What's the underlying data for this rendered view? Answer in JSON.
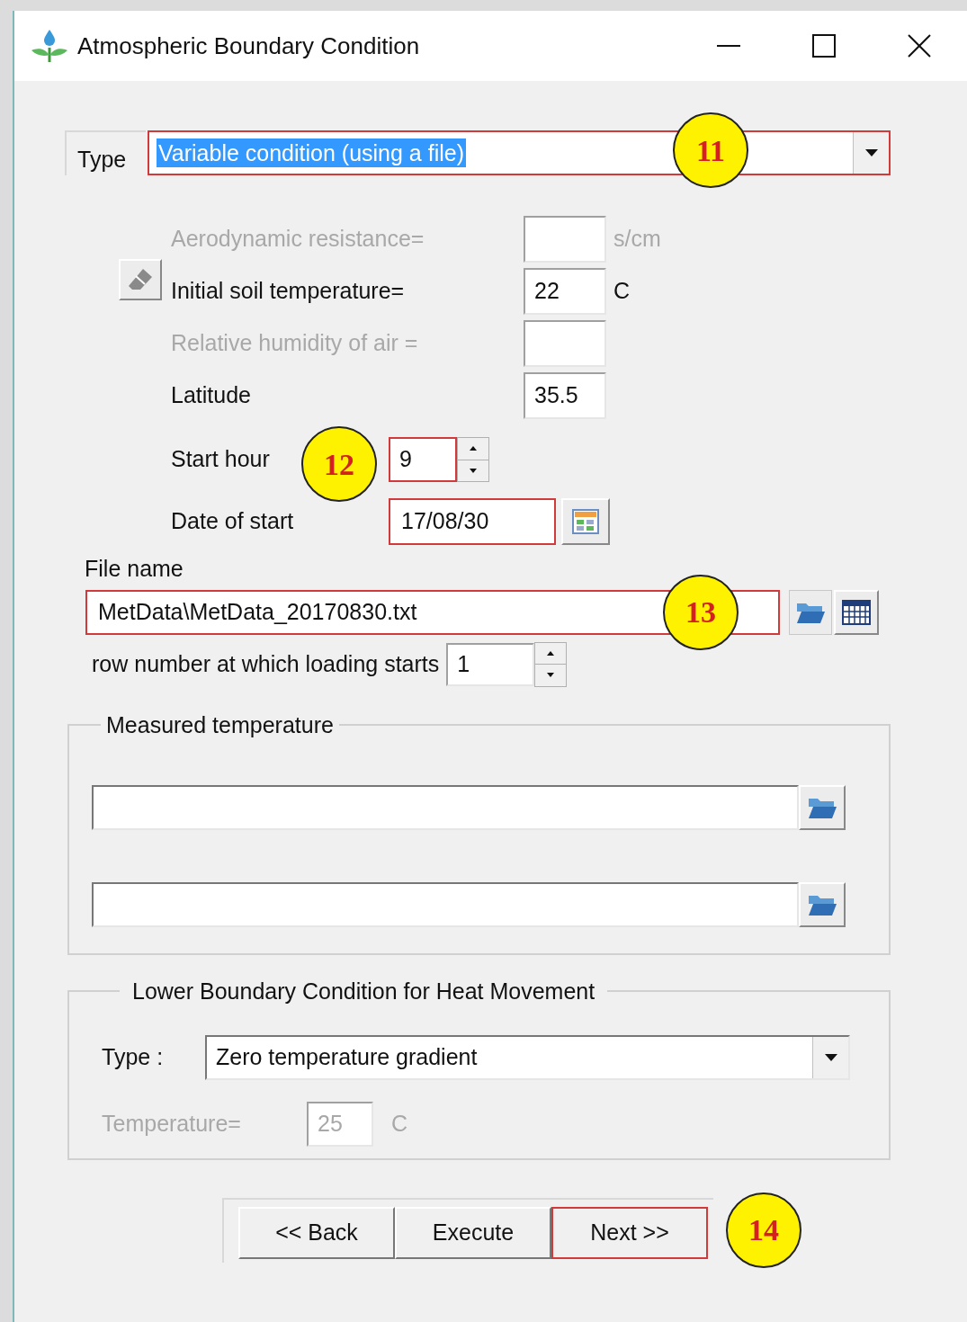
{
  "window": {
    "title": "Atmospheric Boundary Condition"
  },
  "type": {
    "label": "Type",
    "value": "Variable condition (using a file)",
    "highlighted": true,
    "callout": "11"
  },
  "parameters": [
    {
      "label": "Aerodynamic resistance=",
      "unit": "s/cm",
      "disabled": true
    },
    {
      "label": "Initial soil temperature=",
      "value": "22",
      "unit": "C",
      "disabled": false
    },
    {
      "label": "Relative humidity of air =",
      "disabled": true
    },
    {
      "label": "Latitude",
      "value": "35.5",
      "disabled": false
    }
  ],
  "start_hour": {
    "label": "Start hour",
    "value": "9",
    "highlighted": true,
    "callout": "12"
  },
  "date_of_start": {
    "label": "Date of start",
    "value": "17/08/30",
    "highlighted": true
  },
  "file": {
    "label": "File name",
    "value": "MetData\\MetData_20170830.txt",
    "highlighted": true,
    "callout": "13"
  },
  "row_start": {
    "label": "row number at which loading starts",
    "value": "1"
  },
  "measured_temperature": {
    "title": "Measured temperature",
    "fields": [
      {
        "disabled": false
      },
      {
        "disabled": false
      }
    ]
  },
  "lower_boundary": {
    "title": "Lower Boundary Condition for Heat Movement",
    "type_label": "Type :",
    "type_value": "Zero temperature gradient",
    "temperature": {
      "label": "Temperature=",
      "value": "25",
      "unit": "C",
      "disabled": true
    }
  },
  "buttons": [
    {
      "label": "<< Back",
      "highlighted": false
    },
    {
      "label": "Execute",
      "highlighted": false
    },
    {
      "label": "Next >>",
      "highlighted": true,
      "callout": "14"
    }
  ]
}
